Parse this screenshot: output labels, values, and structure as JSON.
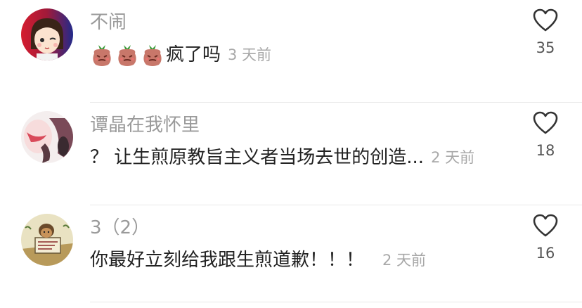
{
  "comments": [
    {
      "username": "不闹",
      "text": "疯了吗",
      "emoji_prefix": [
        "angry-bag-emoji",
        "angry-bag-emoji",
        "angry-bag-emoji"
      ],
      "time": "3 天前",
      "likes": "35"
    },
    {
      "username": "谭晶在我怀里",
      "text": "？ 让生煎原教旨主义者当场去世的创造...",
      "emoji_prefix": [],
      "time": "2 天前",
      "likes": "18"
    },
    {
      "username": "3（2）",
      "text": "你最好立刻给我跟生煎道歉！！！",
      "emoji_prefix": [],
      "time": "2 天前",
      "likes": "16"
    }
  ],
  "icons": {
    "like": "heart-outline-icon"
  },
  "colors": {
    "username": "#9a9a9a",
    "text": "#222222",
    "timestamp": "#a8a8a8",
    "divider": "#e8e8e8"
  }
}
